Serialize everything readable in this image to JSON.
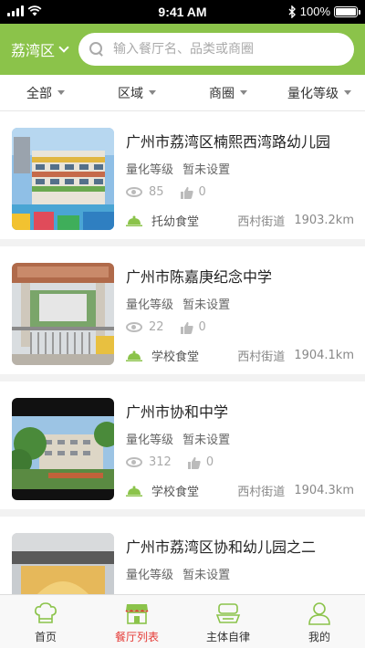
{
  "status_bar": {
    "time": "9:41 AM",
    "battery": "100%"
  },
  "header": {
    "district": "荔湾区",
    "search_placeholder": "输入餐厅名、品类或商圈"
  },
  "filters": [
    "全部",
    "区域",
    "商圈",
    "量化等级"
  ],
  "restaurants": [
    {
      "name": "广州市荔湾区楠熙西湾路幼儿园",
      "grade_label": "量化等级",
      "grade_value": "暂未设置",
      "views": "85",
      "likes": "0",
      "type": "托幼食堂",
      "street": "西村街道",
      "distance": "1903.2km"
    },
    {
      "name": "广州市陈嘉庚纪念中学",
      "grade_label": "量化等级",
      "grade_value": "暂未设置",
      "views": "22",
      "likes": "0",
      "type": "学校食堂",
      "street": "西村街道",
      "distance": "1904.1km"
    },
    {
      "name": "广州市协和中学",
      "grade_label": "量化等级",
      "grade_value": "暂未设置",
      "views": "312",
      "likes": "0",
      "type": "学校食堂",
      "street": "西村街道",
      "distance": "1904.3km"
    },
    {
      "name": "广州市荔湾区协和幼儿园之二",
      "grade_label": "量化等级",
      "grade_value": "暂未设置",
      "views": "",
      "likes": "",
      "type": "",
      "street": "",
      "distance": ""
    }
  ],
  "tabs": [
    {
      "label": "首页",
      "icon": "chef-hat-icon",
      "active": false
    },
    {
      "label": "餐厅列表",
      "icon": "storefront-icon",
      "active": true
    },
    {
      "label": "主体自律",
      "icon": "dish-icon",
      "active": false
    },
    {
      "label": "我的",
      "icon": "person-icon",
      "active": false
    }
  ],
  "colors": {
    "brand": "#8bc34a",
    "active_tab": "#e53935"
  }
}
